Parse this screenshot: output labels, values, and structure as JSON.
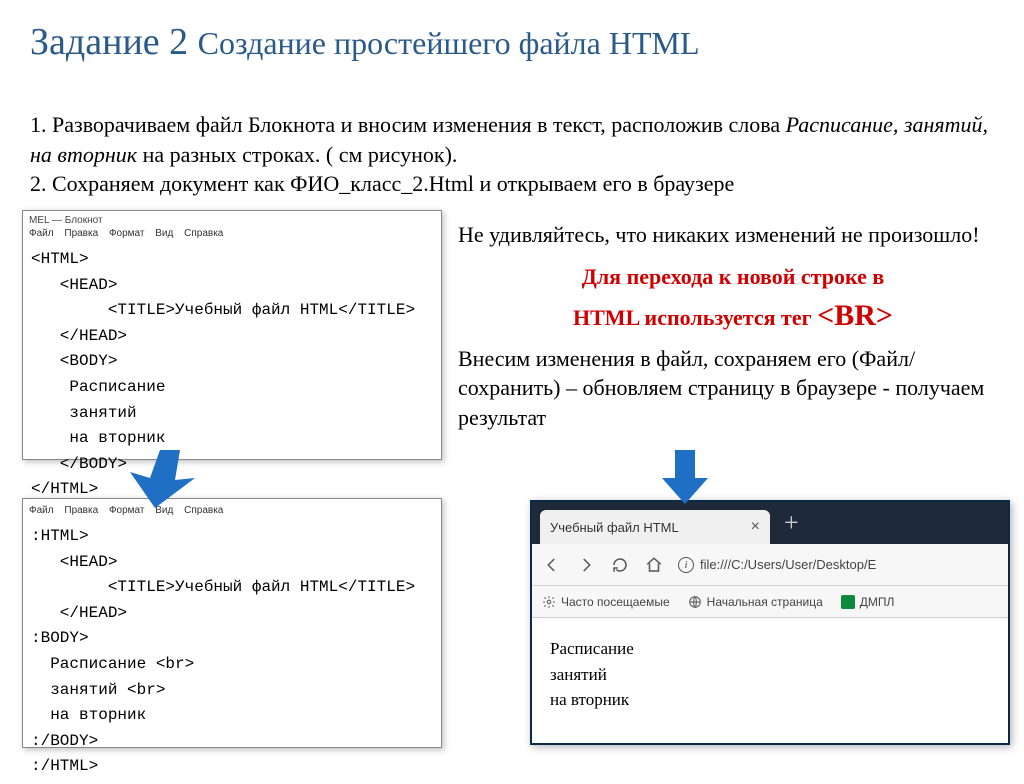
{
  "slide": {
    "title_prefix": "Задание 2 ",
    "title_main": "Создание простейшего файла HTML"
  },
  "instructions": {
    "line1_a": "1. Разворачиваем файл Блокнота и вносим изменения в текст, расположив слова ",
    "line1_italic": "Расписание, занятий, на вторник",
    "line1_b": " на разных строках. ( см рисунок).",
    "line2": "2. Сохраняем документ как ФИО_класс_2.Html и открываем его в браузере"
  },
  "notepad": {
    "window_title": "MEL — Блокнот",
    "menu": {
      "m1": "Файл",
      "m2": "Правка",
      "m3": "Формат",
      "m4": "Вид",
      "m5": "Справка"
    },
    "code1": "<HTML>\n   <HEAD>\n        <TITLE>Учебный файл HTML</TITLE>\n   </HEAD>\n   <BODY>\n    Расписание\n    занятий\n    на вторник\n   </BODY>\n</HTML>",
    "code2": ":HTML>\n   <HEAD>\n        <TITLE>Учебный файл HTML</TITLE>\n   </HEAD>\n:BODY>\n  Расписание <br>\n  занятий <br>\n  на вторник\n:/BODY>\n:/HTML>"
  },
  "right": {
    "surprise": "Не удивляйтесь, что никаких изменений не произошло!",
    "red1": "Для перехода к новой строке в",
    "red2a": "HTML используется тег ",
    "red2b": "<BR>",
    "changes": "Внесим изменения в файл, сохраняем его (Файл/сохранить) – обновляем страницу в браузере - получаем результат"
  },
  "browser": {
    "tab_title": "Учебный файл HTML",
    "url": "file:///C:/Users/User/Desktop/E",
    "bookmarks": {
      "b1": "Часто посещаемые",
      "b2": "Начальная страница",
      "b3": "ДМПЛ"
    },
    "content": {
      "l1": "Расписание",
      "l2": "занятий",
      "l3": "на вторник"
    }
  }
}
